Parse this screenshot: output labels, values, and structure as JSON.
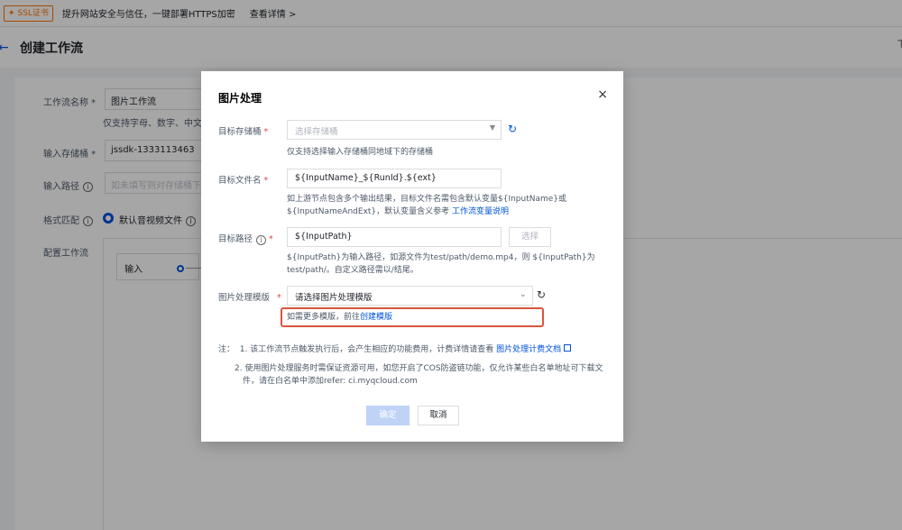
{
  "banner": {
    "badge": "✦ SSL证书",
    "text": "提升网站安全与信任，一键部署HTTPS加密",
    "link": "查看详情 >"
  },
  "header": {
    "title": "创建工作流"
  },
  "background_form": {
    "workflow_name_label": "工作流名称 *",
    "workflow_name_value": "图片工作流",
    "workflow_name_hint": "仅支持字母、数字、中文、_",
    "bucket_label": "输入存储桶 *",
    "bucket_value": "jssdk-1333113463",
    "path_label": "输入路径",
    "path_placeholder": "如未填写则对存储桶下所有",
    "format_label": "格式匹配",
    "format_option": "默认音视频文件",
    "config_label": "配置工作流",
    "flow_input_label": "输入"
  },
  "modal": {
    "title": "图片处理",
    "close_icon": "×",
    "target_bucket": {
      "label": "目标存储桶",
      "placeholder": "选择存储桶",
      "hint": "仅支持选择输入存储桶同地域下的存储桶"
    },
    "target_filename": {
      "label": "目标文件名",
      "value": "${InputName}_${RunId}.${ext}",
      "hint_line1": "如上游节点包含多个输出结果，目标文件名需包含默认变量${InputName}或",
      "hint_line2": "${InputNameAndExt}，默认变量含义参考",
      "hint_link": "工作流变量说明"
    },
    "target_path": {
      "label": "目标路径",
      "value": "${InputPath}",
      "select_button": "选择",
      "hint_line1": "${InputPath}为输入路径，如源文件为test/path/demo.mp4，则 ${InputPath}为",
      "hint_line2": "test/path/。自定义路径需以/结尾。"
    },
    "template": {
      "label": "图片处理模版",
      "placeholder": "请选择图片处理模版",
      "hint_text": "如需更多模版，前往",
      "hint_link": "创建模版"
    },
    "notes": {
      "prefix": "注：",
      "note1": "1. 该工作流节点触发执行后，会产生相应的功能费用，计费详情请查看",
      "note1_link": "图片处理计费文档",
      "note2_line1": "2. 使用图片处理服务时需保证资源可用，如您开启了COS防盗链功能，仅允许某些白名单地址可下载文",
      "note2_line2": "件，请在白名单中添加refer: ci.myqcloud.com"
    },
    "ok_button": "确定",
    "cancel_button": "取消",
    "required_mark": "*",
    "colors": {
      "primary": "#0052d9",
      "ok_disabled": "#bfd3f7",
      "highlight_border": "#d9553d",
      "required": "#e54545"
    }
  }
}
